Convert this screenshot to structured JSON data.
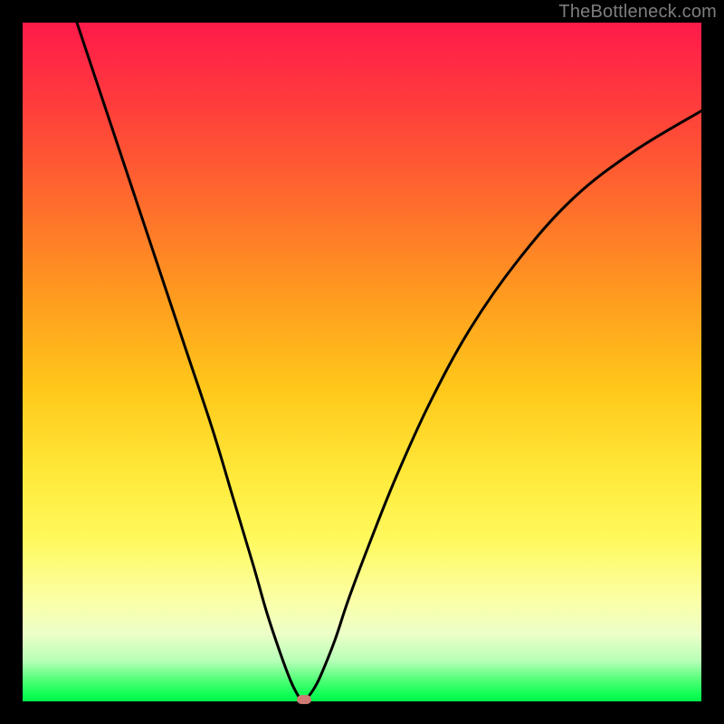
{
  "watermark": "TheBottleneck.com",
  "chart_data": {
    "type": "line",
    "title": "",
    "xlabel": "",
    "ylabel": "",
    "xlim": [
      0,
      100
    ],
    "ylim": [
      0,
      100
    ],
    "grid": false,
    "legend": false,
    "series": [
      {
        "name": "bottleneck-curve",
        "x": [
          8,
          12,
          16,
          20,
          24,
          28,
          31,
          34,
          36,
          38,
          39.5,
          40.5,
          41.2,
          42,
          43,
          44,
          46,
          48,
          51,
          55,
          60,
          66,
          73,
          81,
          90,
          100
        ],
        "y": [
          100,
          88,
          76,
          64,
          52,
          40,
          30,
          20,
          13,
          7,
          3,
          1,
          0,
          0.6,
          2,
          4,
          9,
          15,
          23,
          33,
          44,
          55,
          65,
          74,
          81,
          87
        ]
      }
    ],
    "vertex_marker": {
      "x": 41.4,
      "y": 0.3,
      "color": "#cf7a74"
    }
  },
  "gradient_stops": [
    {
      "pct": 0,
      "color": "#ff1a4b"
    },
    {
      "pct": 50,
      "color": "#ffd020"
    },
    {
      "pct": 85,
      "color": "#fdff90"
    },
    {
      "pct": 100,
      "color": "#00f04a"
    }
  ]
}
